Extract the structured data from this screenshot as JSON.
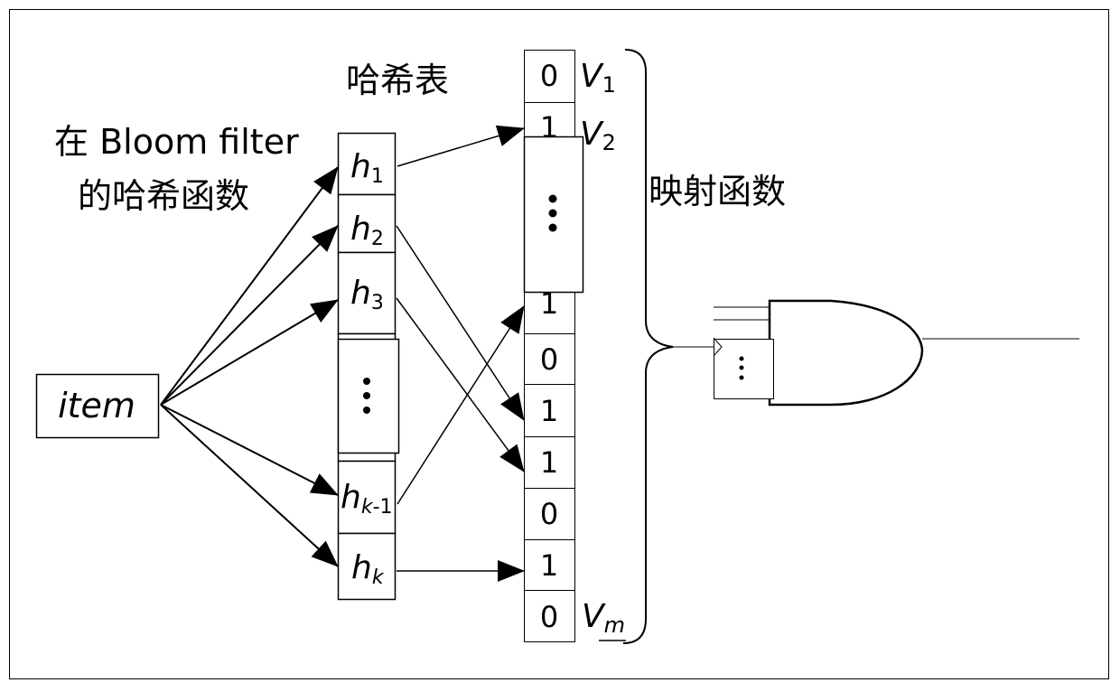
{
  "labels": {
    "hash_funcs_line1": "在 Bloom filter",
    "hash_funcs_line2": "的哈希函数",
    "hash_table": "哈希表",
    "mapping_function": "映射函数",
    "item": "item"
  },
  "hash_functions": [
    {
      "base": "h",
      "sub": "1"
    },
    {
      "base": "h",
      "sub": "2"
    },
    {
      "base": "h",
      "sub": "3"
    },
    {
      "base": "⋮",
      "sub": ""
    },
    {
      "base": "h",
      "sub": "k-1"
    },
    {
      "base": "h",
      "sub": "k"
    }
  ],
  "bit_array": [
    "0",
    "1",
    "⋮",
    "1",
    "0",
    "1",
    "1",
    "0",
    "1",
    "0"
  ],
  "bit_labels": [
    {
      "base": "V",
      "sub": "1"
    },
    {
      "base": "V",
      "sub": "2"
    },
    {
      "base": "V",
      "sub": "m"
    }
  ],
  "ellipsis": "⋮",
  "mappings": [
    {
      "from": "h1",
      "to_bit_index": 1
    },
    {
      "from": "h2",
      "to_bit_index": 5
    },
    {
      "from": "h3",
      "to_bit_index": 6
    },
    {
      "from": "hk-1",
      "to_bit_index": 3
    },
    {
      "from": "hk",
      "to_bit_index": 8
    }
  ],
  "gate": {
    "type": "AND",
    "inputs_label": "⋮"
  }
}
